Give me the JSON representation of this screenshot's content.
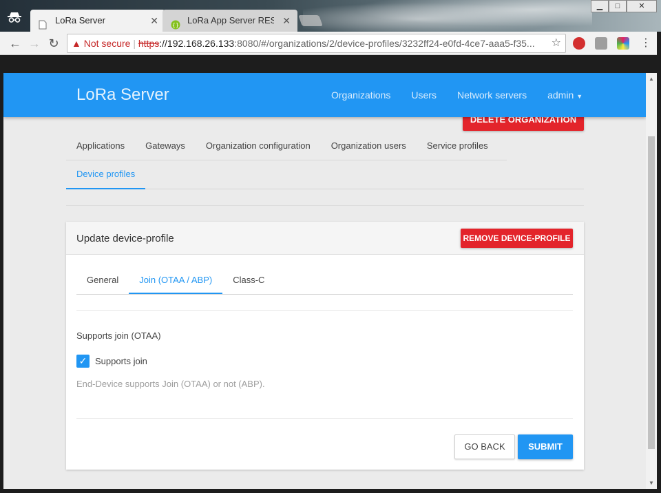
{
  "browser": {
    "tabs": [
      {
        "title": "LoRa Server",
        "active": true
      },
      {
        "title": "LoRa App Server REST API",
        "active": false
      }
    ],
    "window_buttons": {
      "minimize": "▁",
      "maximize": "□",
      "close": "✕"
    },
    "address": {
      "security_label": "Not secure",
      "scheme": "https",
      "host": "://192.168.26.133",
      "rest": ":8080/#/organizations/2/device-profiles/3232ff24-e0fd-4ce7-aaa5-f35..."
    },
    "icons": {
      "back": "arrow-left-icon",
      "forward": "arrow-right-icon",
      "reload": "reload-icon",
      "star": "star-icon"
    }
  },
  "app": {
    "brand": "LoRa Server",
    "nav": {
      "organizations": "Organizations",
      "users": "Users",
      "network_servers": "Network servers",
      "admin": "admin"
    },
    "colors": {
      "primary": "#2196f3",
      "danger": "#e3242b"
    }
  },
  "org": {
    "delete_label": "DELETE ORGANIZATION",
    "tabs": [
      "Applications",
      "Gateways",
      "Organization configuration",
      "Organization users",
      "Service profiles"
    ],
    "active_tab": "Device profiles"
  },
  "card": {
    "title": "Update device-profile",
    "remove_label": "REMOVE DEVICE-PROFILE",
    "tabs": {
      "general": "General",
      "join": "Join (OTAA / ABP)",
      "classc": "Class-C"
    },
    "field_label": "Supports join (OTAA)",
    "checkbox_label": "Supports join",
    "checkbox_checked": true,
    "helper": "End-Device supports Join (OTAA) or not (ABP).",
    "back_label": "GO BACK",
    "submit_label": "SUBMIT"
  }
}
